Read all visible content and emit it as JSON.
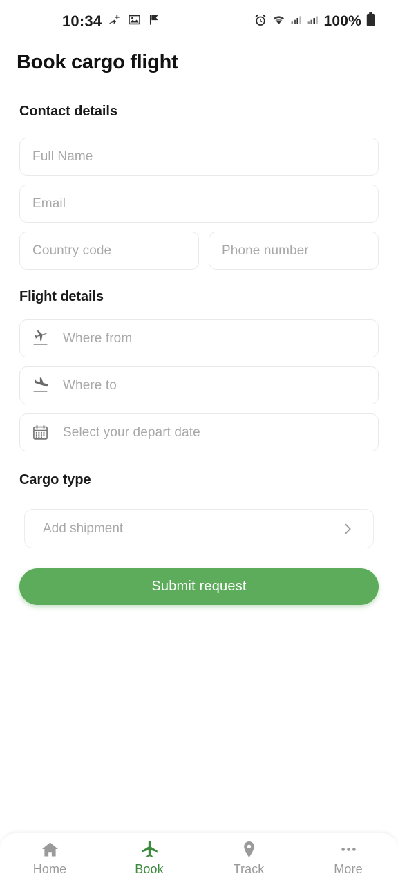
{
  "status_bar": {
    "time": "10:34",
    "battery_percent": "100%",
    "left_icons": [
      "sync-notification-icon",
      "image-notification-icon",
      "flag-notification-icon"
    ],
    "right_icons": [
      "alarm-icon",
      "wifi-icon",
      "signal-bars-icon",
      "signal-bars-2-icon",
      "battery-icon"
    ]
  },
  "header": {
    "title": "Book cargo flight"
  },
  "sections": {
    "contact": {
      "title": "Contact details",
      "fields": [
        {
          "name": "full-name",
          "placeholder": "Full Name"
        },
        {
          "name": "email",
          "placeholder": "Email"
        },
        {
          "name": "country-code",
          "placeholder": "Country code"
        },
        {
          "name": "phone-number",
          "placeholder": "Phone number"
        }
      ]
    },
    "flight": {
      "title": "Flight details",
      "fields": [
        {
          "name": "where-from",
          "placeholder": "Where from",
          "icon": "flight-takeoff-icon"
        },
        {
          "name": "where-to",
          "placeholder": "Where to",
          "icon": "flight-land-icon"
        },
        {
          "name": "depart-date",
          "placeholder": "Select your depart date",
          "icon": "calendar-icon"
        }
      ]
    },
    "cargo": {
      "title": "Cargo type",
      "add_shipment_label": "Add shipment",
      "chevron_icon": "chevron-right-icon"
    }
  },
  "submit": {
    "label": "Submit request"
  },
  "bottom_nav": {
    "items": [
      {
        "label": "Home",
        "icon": "home-icon",
        "active": false
      },
      {
        "label": "Book",
        "icon": "airplane-icon",
        "active": true
      },
      {
        "label": "Track",
        "icon": "location-pin-icon",
        "active": false
      },
      {
        "label": "More",
        "icon": "ellipsis-icon",
        "active": false
      }
    ]
  },
  "colors": {
    "primary_green": "#5cac5c",
    "active_green": "#3d8b3f",
    "placeholder_gray": "#a8a8a8",
    "border_gray": "#e9e9e9",
    "text_dark": "#111111"
  }
}
